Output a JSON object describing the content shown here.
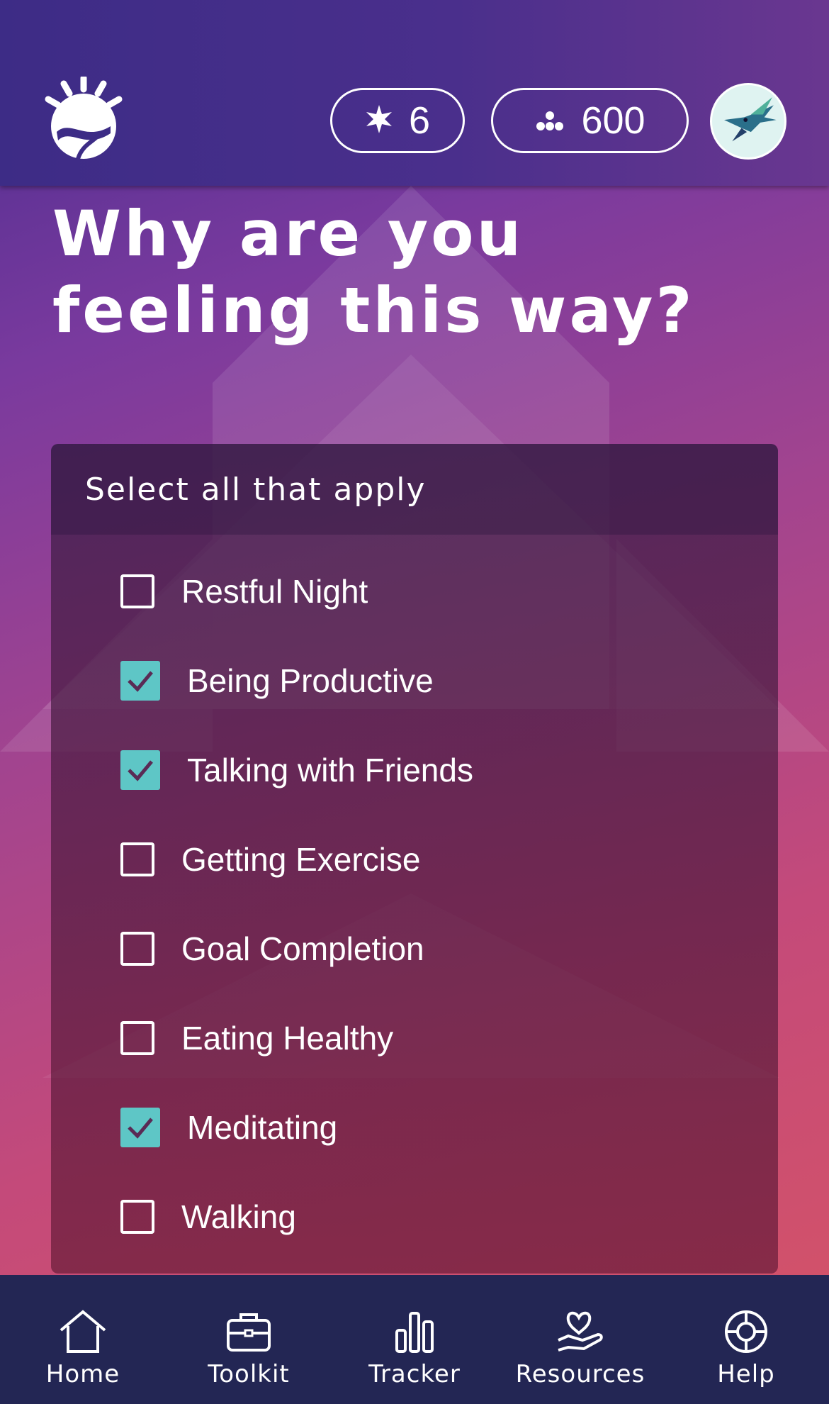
{
  "header": {
    "logo_icon": "sunrise-logo-icon",
    "streak": {
      "icon": "star-burst-icon",
      "value": "6"
    },
    "points": {
      "icon": "dots-cluster-icon",
      "value": "600"
    },
    "avatar_icon": "hummingbird-avatar-icon"
  },
  "page": {
    "title": "Why are you feeling this way?"
  },
  "card": {
    "instruction": "Select all that apply",
    "options": [
      {
        "label": "Restful Night",
        "checked": false
      },
      {
        "label": "Being Productive",
        "checked": true
      },
      {
        "label": "Talking with Friends",
        "checked": true
      },
      {
        "label": "Getting Exercise",
        "checked": false
      },
      {
        "label": "Goal Completion",
        "checked": false
      },
      {
        "label": "Eating Healthy",
        "checked": false
      },
      {
        "label": "Meditating",
        "checked": true
      },
      {
        "label": "Walking",
        "checked": false
      }
    ]
  },
  "nav": {
    "items": [
      {
        "label": "Home",
        "icon": "home-icon"
      },
      {
        "label": "Toolkit",
        "icon": "toolbox-icon"
      },
      {
        "label": "Tracker",
        "icon": "bar-chart-icon"
      },
      {
        "label": "Resources",
        "icon": "heart-hand-icon"
      },
      {
        "label": "Help",
        "icon": "lifebuoy-icon"
      }
    ]
  },
  "colors": {
    "accent_check": "#5ec6c6",
    "nav_background": "#232654",
    "header_background": "#3d2c86"
  }
}
